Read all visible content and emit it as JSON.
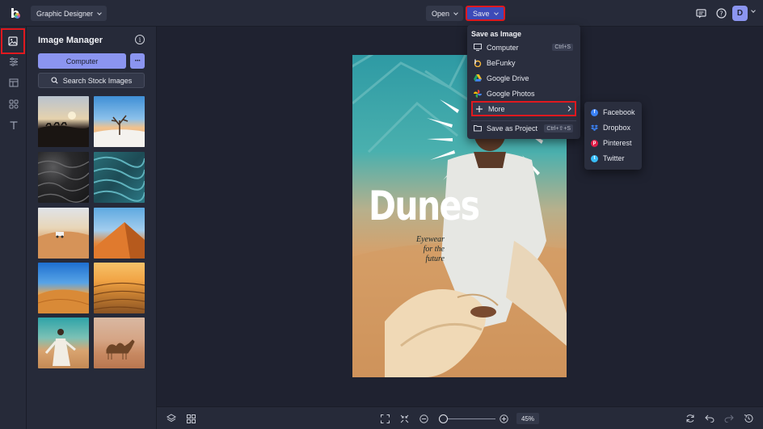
{
  "topbar": {
    "project_name": "Graphic Designer",
    "open_label": "Open",
    "save_label": "Save",
    "avatar_initial": "D"
  },
  "panel": {
    "title": "Image Manager",
    "computer_label": "Computer",
    "more_label": "···",
    "search_label": "Search Stock Images",
    "thumbnails": [
      "camel-caravan-sunset",
      "dead-tree-dune",
      "dark-sand-texture",
      "teal-sand-ripples",
      "jeep-on-dunes",
      "orange-dune-climbers",
      "blue-sky-dunes",
      "golden-sand-ripples",
      "woman-in-white-desert",
      "camel-desert"
    ]
  },
  "artboard": {
    "title": "Dunes",
    "subtitle_lines": [
      "Eyewear",
      "for the",
      "future"
    ]
  },
  "save_menu": {
    "header": "Save as Image",
    "items": [
      {
        "label": "Computer",
        "shortcut": "Ctrl+S",
        "icon": "monitor-icon"
      },
      {
        "label": "BeFunky",
        "icon": "befunky-icon"
      },
      {
        "label": "Google Drive",
        "icon": "google-drive-icon"
      },
      {
        "label": "Google Photos",
        "icon": "google-photos-icon"
      },
      {
        "label": "More",
        "icon": "plus-icon"
      },
      {
        "label": "Save as Project",
        "shortcut": "Ctrl+⇧+S",
        "icon": "folder-icon"
      }
    ]
  },
  "more_menu": {
    "items": [
      {
        "label": "Facebook",
        "color": "#3b82f6"
      },
      {
        "label": "Dropbox",
        "color": "#3b82f6"
      },
      {
        "label": "Pinterest",
        "color": "#e11d48"
      },
      {
        "label": "Twitter",
        "color": "#38bdf8"
      }
    ]
  },
  "bottombar": {
    "zoom_value": "45%",
    "zoom_level": 0.08
  },
  "colors": {
    "accent": "#8b95f0",
    "highlight": "#e0191f",
    "background": "#1f2230",
    "panel": "#262a39"
  }
}
